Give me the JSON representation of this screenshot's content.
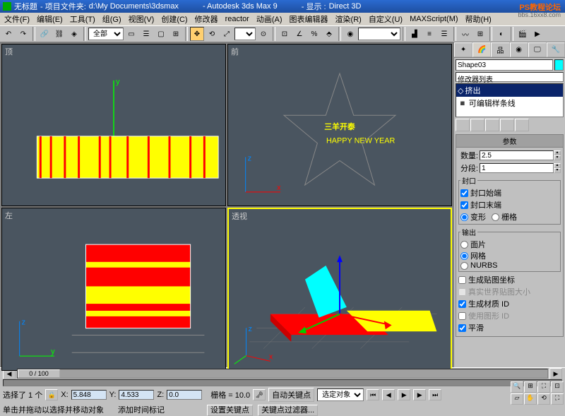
{
  "title": {
    "untitled": "无标题",
    "folder_label": "- 项目文件夹:",
    "folder_path": "d:\\My Documents\\3dsmax",
    "app": "- Autodesk 3ds Max 9",
    "display_label": "- 显示 :",
    "display_api": "Direct 3D"
  },
  "watermark": {
    "line1": "PS教程论坛",
    "line2": "bbs.16xx8.com"
  },
  "menu": [
    "文件(F)",
    "编辑(E)",
    "工具(T)",
    "组(G)",
    "视图(V)",
    "创建(C)",
    "修改器",
    "reactor",
    "动画(A)",
    "图表编辑器",
    "渲染(R)",
    "自定义(U)",
    "MAXScript(M)",
    "帮助(H)"
  ],
  "toolbar": {
    "selset": "全部",
    "dropdown2": ""
  },
  "viewports": {
    "top": "顶",
    "front": "前",
    "left": "左",
    "persp": "透视",
    "text_main": "三羊开泰",
    "text_sub": "HAPPY NEW YEAR"
  },
  "panel": {
    "object_name": "Shape03",
    "mod_dropdown": "修改器列表",
    "stack": {
      "extrude": "挤出",
      "spline": "可编辑样条线"
    },
    "rollout_params": "参数",
    "amount_label": "数量:",
    "amount_val": "2.5",
    "segs_label": "分段:",
    "segs_val": "1",
    "cap_group": "封口",
    "cap_start": "封口始端",
    "cap_end": "封口末端",
    "morph": "变形",
    "grid": "栅格",
    "output_group": "输出",
    "patch": "面片",
    "mesh": "网格",
    "nurbs": "NURBS",
    "gen_map": "生成贴图坐标",
    "real_world": "真实世界贴图大小",
    "gen_mat": "生成材质 ID",
    "use_shape": "使用图形 ID",
    "smooth": "平滑"
  },
  "time": {
    "slider": "0 / 100"
  },
  "status": {
    "sel_info": "选择了 1 个",
    "x_label": "X:",
    "x": "5.848",
    "y_label": "Y:",
    "y": "4.533",
    "z_label": "Z:",
    "z": "0.0",
    "grid_label": "栅格 = 10.0",
    "autokey": "自动关键点",
    "selobj": "选定对象",
    "setkey": "设置关键点",
    "keyfilter": "关键点过滤器...",
    "prompt1": "单击并拖动以选择并移动对象",
    "prompt2": "添加时间标记"
  }
}
